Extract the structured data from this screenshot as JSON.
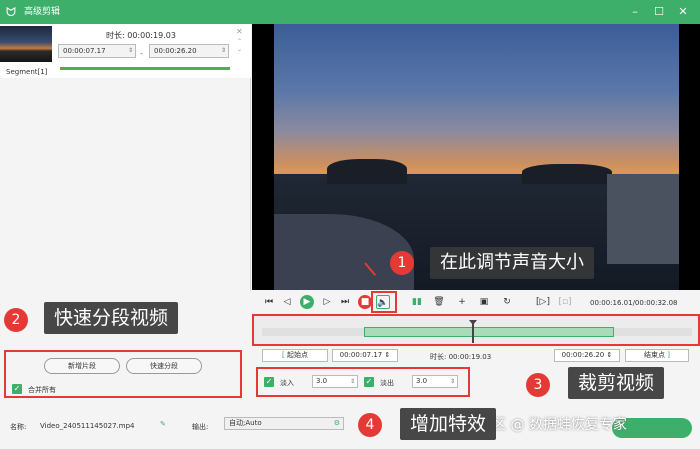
{
  "window": {
    "title": "高级剪辑",
    "controls": [
      "–",
      "☐",
      "✕"
    ]
  },
  "segment": {
    "label": "Segment[1]",
    "duration_label": "时长:",
    "duration_value": "00:00:19.03",
    "start": "00:00:07.17",
    "end": "00:00:26.20"
  },
  "player": {
    "timecode": "00:00:16.01/00:00:32.08"
  },
  "trim": {
    "start_label": "起始点",
    "start_value": "00:00:07.17",
    "duration_label": "时长:",
    "duration_value": "00:00:19.03",
    "end_value": "00:00:26.20",
    "end_label": "结束点"
  },
  "fade": {
    "in_label": "淡入",
    "in_value": "3.0",
    "out_label": "淡出",
    "out_value": "3.0"
  },
  "left_ops": {
    "new_segment": "新增片段",
    "quick_split": "快速分段",
    "merge_all": "合并所有"
  },
  "footer": {
    "name_label": "名称:",
    "name_value": "Video_240511145027.mp4",
    "output_label": "输出:",
    "output_value": "自动;Auto"
  },
  "annotations": {
    "c1": "在此调节声音大小",
    "c2": "快速分段视频",
    "c3": "裁剪视频",
    "c4": "增加特效",
    "n1": "1",
    "n2": "2",
    "n3": "3",
    "n4": "4"
  },
  "watermark": "社区 @ 数据蛙恢复专家",
  "colors": {
    "accent": "#3eae6b",
    "annotation_red": "#e53935"
  }
}
